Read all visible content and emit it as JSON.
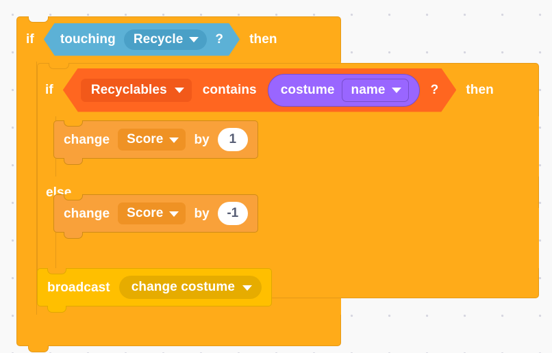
{
  "workspace": {
    "background_color": "#f9f9f9",
    "grid_dot_color": "#d6d6e0"
  },
  "palette": {
    "control_orange": "#ffab19",
    "sensing_blue": "#5cb1d6",
    "operator_orange": "#ff6620",
    "variable_orange": "#f9a13a",
    "looks_purple": "#9966ff",
    "events_yellow": "#ffbf00",
    "text_white": "#ffffff",
    "number_text": "#575e75"
  },
  "script": {
    "outer_if": {
      "if_label": "if",
      "then_label": "then",
      "condition": {
        "block_name": "touching",
        "label": "touching",
        "target_value": "Recycle",
        "dropdown_icon": "chevron-down-icon",
        "question_mark": "?"
      }
    },
    "inner_if_else": {
      "if_label": "if",
      "then_label": "then",
      "else_label": "else",
      "condition": {
        "block_name": "contains",
        "list_value": "Recyclables",
        "list_dropdown_icon": "chevron-down-icon",
        "contains_label": "contains",
        "question_mark": "?",
        "reporter": {
          "block_name": "costume-property",
          "label": "costume",
          "property_value": "name",
          "dropdown_icon": "chevron-down-icon"
        }
      },
      "then_branch": [
        {
          "block_name": "change-variable-by",
          "change_label": "change",
          "variable_value": "Score",
          "dropdown_icon": "chevron-down-icon",
          "by_label": "by",
          "amount": "1"
        }
      ],
      "else_branch": [
        {
          "block_name": "change-variable-by",
          "change_label": "change",
          "variable_value": "Score",
          "dropdown_icon": "chevron-down-icon",
          "by_label": "by",
          "amount": "-1"
        }
      ]
    },
    "broadcast": {
      "block_name": "broadcast",
      "label": "broadcast",
      "message_value": "change costume",
      "dropdown_icon": "chevron-down-icon"
    }
  }
}
